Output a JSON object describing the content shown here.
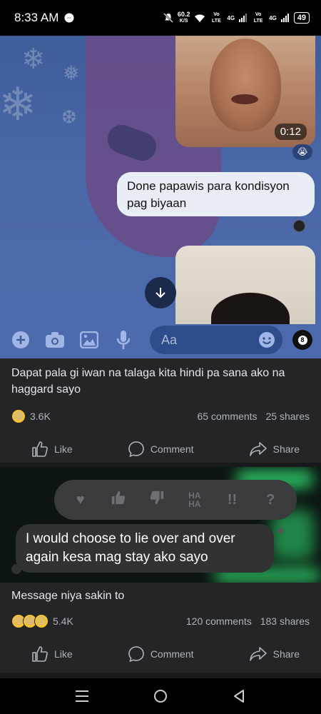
{
  "status_bar": {
    "time": "8:33 AM",
    "net_speed_value": "60.2",
    "net_speed_unit": "K/S",
    "sim1_label": "Vo LTE",
    "sim1_network": "4G",
    "sim2_label": "Vo LTE",
    "sim2_network": "4G",
    "battery": "49"
  },
  "chat": {
    "video1_duration": "0:12",
    "message_text": "Done papawis para kondisyon pag biyaan",
    "composer_placeholder": "Aa",
    "eight_ball_label": "8"
  },
  "post1": {
    "text": "Dapat pala gi iwan na talaga kita hindi pa sana ako na haggard sayo",
    "reactions_count": "3.6K",
    "comments": "65 comments",
    "shares": "25 shares"
  },
  "post2": {
    "image_message": "I would choose to lie over and over again kesa mag stay ako sayo",
    "reaction_bar_haha": "HA HA",
    "reaction_bar_question": "?",
    "text": "Message niya sakin to",
    "reactions_count": "5.4K",
    "comments": "120 comments",
    "shares": "183 shares"
  },
  "actions": {
    "like": "Like",
    "comment": "Comment",
    "share": "Share"
  }
}
